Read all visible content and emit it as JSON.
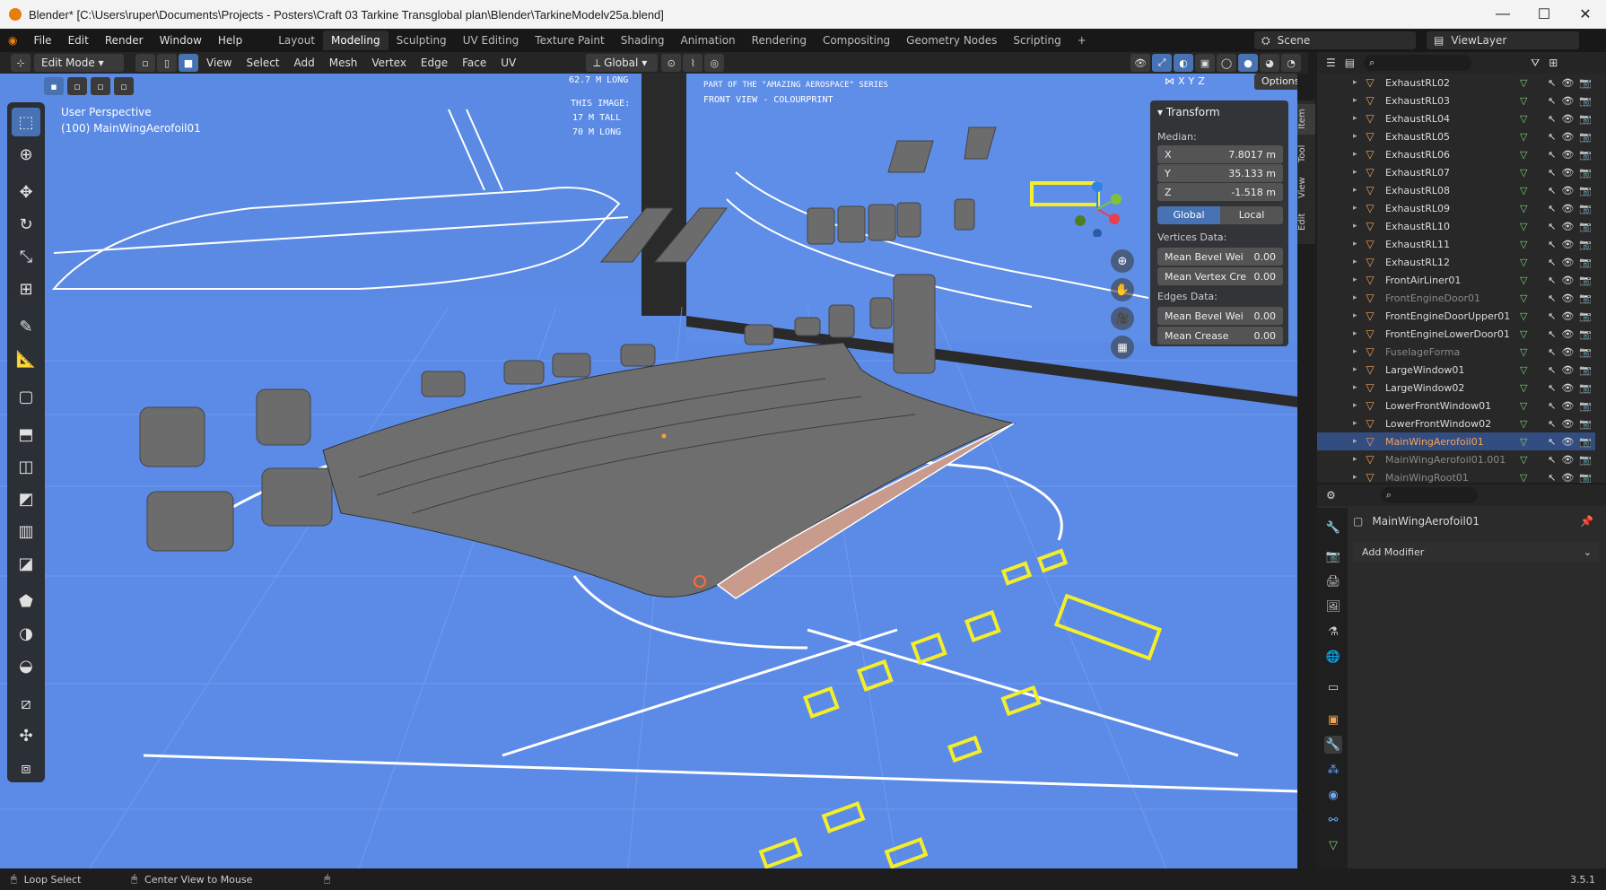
{
  "window": {
    "title": "Blender* [C:\\Users\\ruper\\Documents\\Projects - Posters\\Craft 03 Tarkine Transglobal plan\\Blender\\TarkineModelv25a.blend]",
    "minimize": "—",
    "maximize": "☐",
    "close": "✕"
  },
  "menu": [
    "File",
    "Edit",
    "Render",
    "Window",
    "Help"
  ],
  "workspaces": [
    "Layout",
    "Modeling",
    "Sculpting",
    "UV Editing",
    "Texture Paint",
    "Shading",
    "Animation",
    "Rendering",
    "Compositing",
    "Geometry Nodes",
    "Scripting"
  ],
  "active_workspace": "Modeling",
  "add_workspace": "+",
  "scene": {
    "label": "Scene",
    "viewlayer": "ViewLayer"
  },
  "header3d": {
    "mode": "Edit Mode",
    "menus": [
      "View",
      "Select",
      "Add",
      "Mesh",
      "Vertex",
      "Edge",
      "Face",
      "UV"
    ],
    "orientation": "Global",
    "axes": [
      "X",
      "Y",
      "Z"
    ],
    "options": "Options"
  },
  "viewport": {
    "perspective": "User Perspective",
    "object": "(100) MainWingAerofoil01",
    "bg_color": "#5b8be6",
    "blueprint_text": [
      "62.7 M LONG",
      "THIS IMAGE:",
      "17 M TALL",
      "70 M LONG",
      "PART OF THE \"AMAZING AEROSPACE\" SERIES",
      "FRONT VIEW - COLOURPRINT"
    ]
  },
  "npanel": {
    "title": "Transform",
    "median": "Median:",
    "x_label": "X",
    "x_value": "7.8017 m",
    "y_label": "Y",
    "y_value": "35.133 m",
    "z_label": "Z",
    "z_value": "-1.518 m",
    "global": "Global",
    "local": "Local",
    "vertices_data": "Vertices Data:",
    "mean_bevel_v": "Mean Bevel Wei",
    "mean_bevel_v_val": "0.00",
    "mean_vertex_crease": "Mean Vertex Cre",
    "mean_vertex_crease_val": "0.00",
    "edges_data": "Edges Data:",
    "mean_bevel_e": "Mean Bevel Wei",
    "mean_bevel_e_val": "0.00",
    "mean_crease": "Mean Crease",
    "mean_crease_val": "0.00",
    "tabs": [
      "Item",
      "Tool",
      "View",
      "Edit"
    ]
  },
  "outliner": {
    "items": [
      {
        "name": "ExhaustRL02",
        "dim": false
      },
      {
        "name": "ExhaustRL03",
        "dim": false
      },
      {
        "name": "ExhaustRL04",
        "dim": false
      },
      {
        "name": "ExhaustRL05",
        "dim": false
      },
      {
        "name": "ExhaustRL06",
        "dim": false
      },
      {
        "name": "ExhaustRL07",
        "dim": false
      },
      {
        "name": "ExhaustRL08",
        "dim": false
      },
      {
        "name": "ExhaustRL09",
        "dim": false
      },
      {
        "name": "ExhaustRL10",
        "dim": false
      },
      {
        "name": "ExhaustRL11",
        "dim": false
      },
      {
        "name": "ExhaustRL12",
        "dim": false
      },
      {
        "name": "FrontAirLiner01",
        "dim": false
      },
      {
        "name": "FrontEngineDoor01",
        "dim": true
      },
      {
        "name": "FrontEngineDoorUpper01",
        "dim": false
      },
      {
        "name": "FrontEngineLowerDoor01",
        "dim": false
      },
      {
        "name": "FuselageForma",
        "dim": true
      },
      {
        "name": "LargeWindow01",
        "dim": false
      },
      {
        "name": "LargeWindow02",
        "dim": false
      },
      {
        "name": "LowerFrontWindow01",
        "dim": false
      },
      {
        "name": "LowerFrontWindow02",
        "dim": false
      },
      {
        "name": "MainWingAerofoil01",
        "dim": false,
        "selected": true
      },
      {
        "name": "MainWingAerofoil01.001",
        "dim": true
      },
      {
        "name": "MainWingRoot01",
        "dim": true
      }
    ]
  },
  "properties": {
    "object_name": "MainWingAerofoil01",
    "add_modifier": "Add Modifier"
  },
  "status": {
    "left": "Loop Select",
    "mid": "Center View to Mouse",
    "version": "3.5.1"
  },
  "colors": {
    "accent": "#4772b3",
    "blueprint_line": "#ffffff",
    "highlight_yellow": "#f4ee2a",
    "object_orange": "#f1a35a"
  }
}
